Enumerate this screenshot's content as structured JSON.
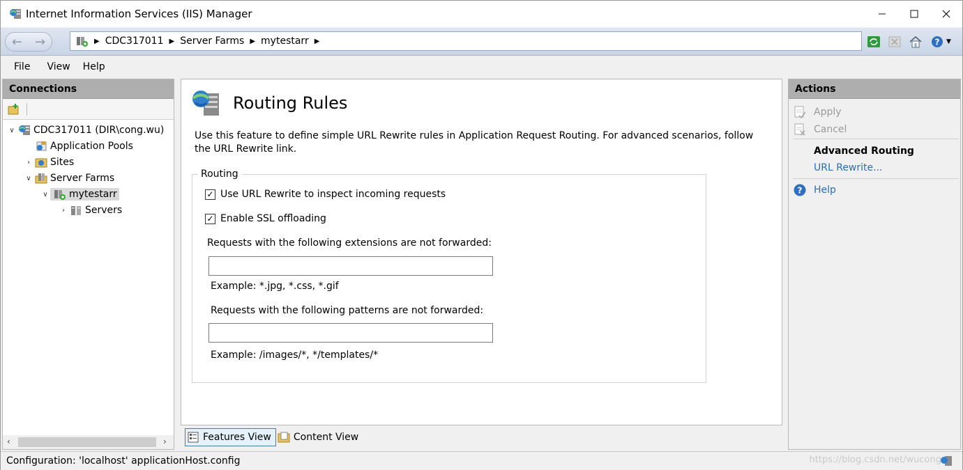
{
  "window": {
    "title": "Internet Information Services (IIS) Manager"
  },
  "address": {
    "crumbs": [
      "CDC317011",
      "Server Farms",
      "mytestarr"
    ]
  },
  "menu": {
    "file": "File",
    "view": "View",
    "help": "Help"
  },
  "connections": {
    "header": "Connections",
    "tree": {
      "server": "CDC317011 (DIR\\cong.wu)",
      "app_pools": "Application Pools",
      "sites": "Sites",
      "server_farms": "Server Farms",
      "farm": "mytestarr",
      "servers": "Servers"
    }
  },
  "main": {
    "title": "Routing Rules",
    "description": "Use this feature to define simple URL Rewrite rules in Application Request Routing.  For advanced scenarios, follow the URL Rewrite link.",
    "group_label": "Routing",
    "use_url_rewrite": {
      "label": "Use URL Rewrite to inspect incoming requests",
      "checked": true
    },
    "enable_ssl": {
      "label": "Enable SSL offloading",
      "checked": true
    },
    "extensions_label": "Requests with the following extensions are not forwarded:",
    "extensions_value": "",
    "extensions_example": "Example: *.jpg, *.css, *.gif",
    "patterns_label": "Requests with the following patterns are not forwarded:",
    "patterns_value": "",
    "patterns_example": "Example: /images/*, */templates/*"
  },
  "view_tabs": {
    "features": "Features View",
    "content": "Content View"
  },
  "actions": {
    "header": "Actions",
    "apply": "Apply",
    "cancel": "Cancel",
    "advanced_routing": "Advanced Routing",
    "url_rewrite": "URL Rewrite...",
    "help": "Help"
  },
  "status": {
    "text": "Configuration: 'localhost' applicationHost.config",
    "watermark": "https://blog.csdn.net/wucong"
  }
}
